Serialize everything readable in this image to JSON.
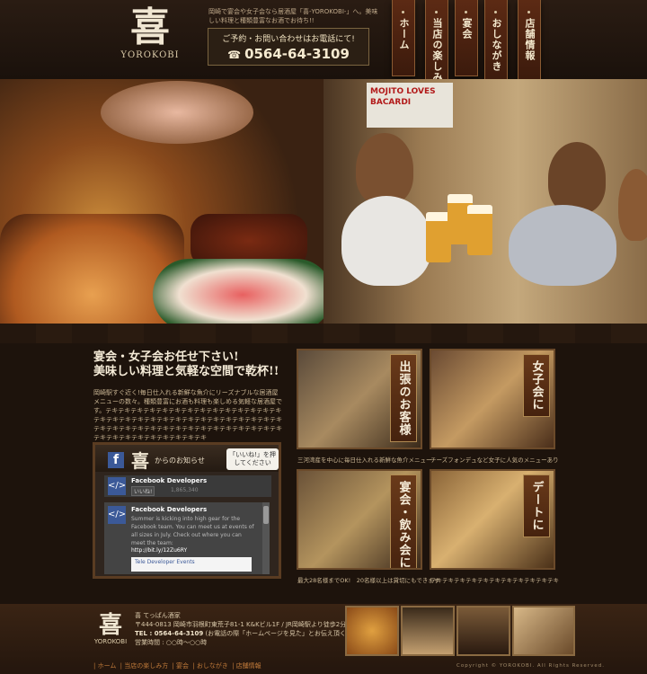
{
  "header": {
    "logo_kanji": "喜",
    "logo_roman": "YOROKOBI",
    "intro": "岡崎で宴会や女子会なら居酒屋「喜-YOROKOBI-」へ。美味しい料理と種類豊富なお酒でお待ち!!",
    "phone_label": "ご予約・お問い合わせはお電話にて!",
    "phone_number": "0564-64-3109",
    "nav": [
      "ホーム",
      "当店の楽しみ方",
      "宴会",
      "おしながき",
      "店舗情報"
    ]
  },
  "hero": {
    "poster_text": "MOJITO LOVES BACARDI"
  },
  "main": {
    "headline1": "宴会・女子会お任せ下さい!",
    "headline2": "美味しい料理と気軽な空間で乾杯!!",
    "body": "岡崎駅すぐ近く!毎日仕入れる新鮮な魚介にリーズナブルな居酒屋メニューの数々。種類豊富にお酒も料理も楽しめる気軽な居酒屋です。テキテキテキテキテキテキテキテキテキテキテキテキテキテキテキテキテキテキテキテキテキテキテキテキテキテキテキテキテキテキテキテキテキテキテキテキテキテキテキテキテキテキテキテキテキテキテキテキテキテキテキテキテキ"
  },
  "facebook": {
    "logo_kanji": "喜",
    "logo_roman": "YOROKOBI",
    "oshirase": "からのお知らせ",
    "like_prompt": "「いいね!」を押してください",
    "page_name": "Facebook Developers",
    "like_button": "いいね!",
    "like_count": "1,865,340",
    "post_name": "Facebook Developers",
    "post_text": "Summer is kicking into high gear for the Facebook team. You can meet us at events of all sizes in July. Check out where you can meet the team:",
    "post_link": "http://bit.ly/12Zu6RY",
    "post_box": "Tele Developer Events"
  },
  "cards": [
    {
      "title": "出張のお客様",
      "caption": "三河湾産を中心に毎日仕入れる新鮮な魚介メニュー"
    },
    {
      "title": "女子会に",
      "caption": "チーズフォンデュなど女子に人気のメニューあり"
    },
    {
      "title": "宴会・飲み会に",
      "caption": "最大28名様までOK!　20名様以上は貸切にもできます"
    },
    {
      "title": "デートに",
      "caption": "テキテキテキテキテキテキテキテキテキテキテキ"
    }
  ],
  "footer": {
    "logo_kanji": "喜",
    "logo_roman": "YOROKOBI",
    "line1": "喜 てっぱん酒家",
    "line2": "〒444-0813 岡崎市羽根町東荒子81-1 K&Kビル1F / JR岡崎駅より徒歩2分",
    "line3_tel": "TEL : 0564-64-3109",
    "line3_note": "(お電話の際「ホームページを見た」とお伝え頂くとスムーズです)",
    "line4": "営業時間 : ○○時～○○時",
    "nav": [
      "| ホーム",
      "| 当店の楽しみ方",
      "| 宴会",
      "| おしながき",
      "| 店舗情報"
    ],
    "copyright": "Copyright © YOROKOBI. All Rights Reserved."
  }
}
